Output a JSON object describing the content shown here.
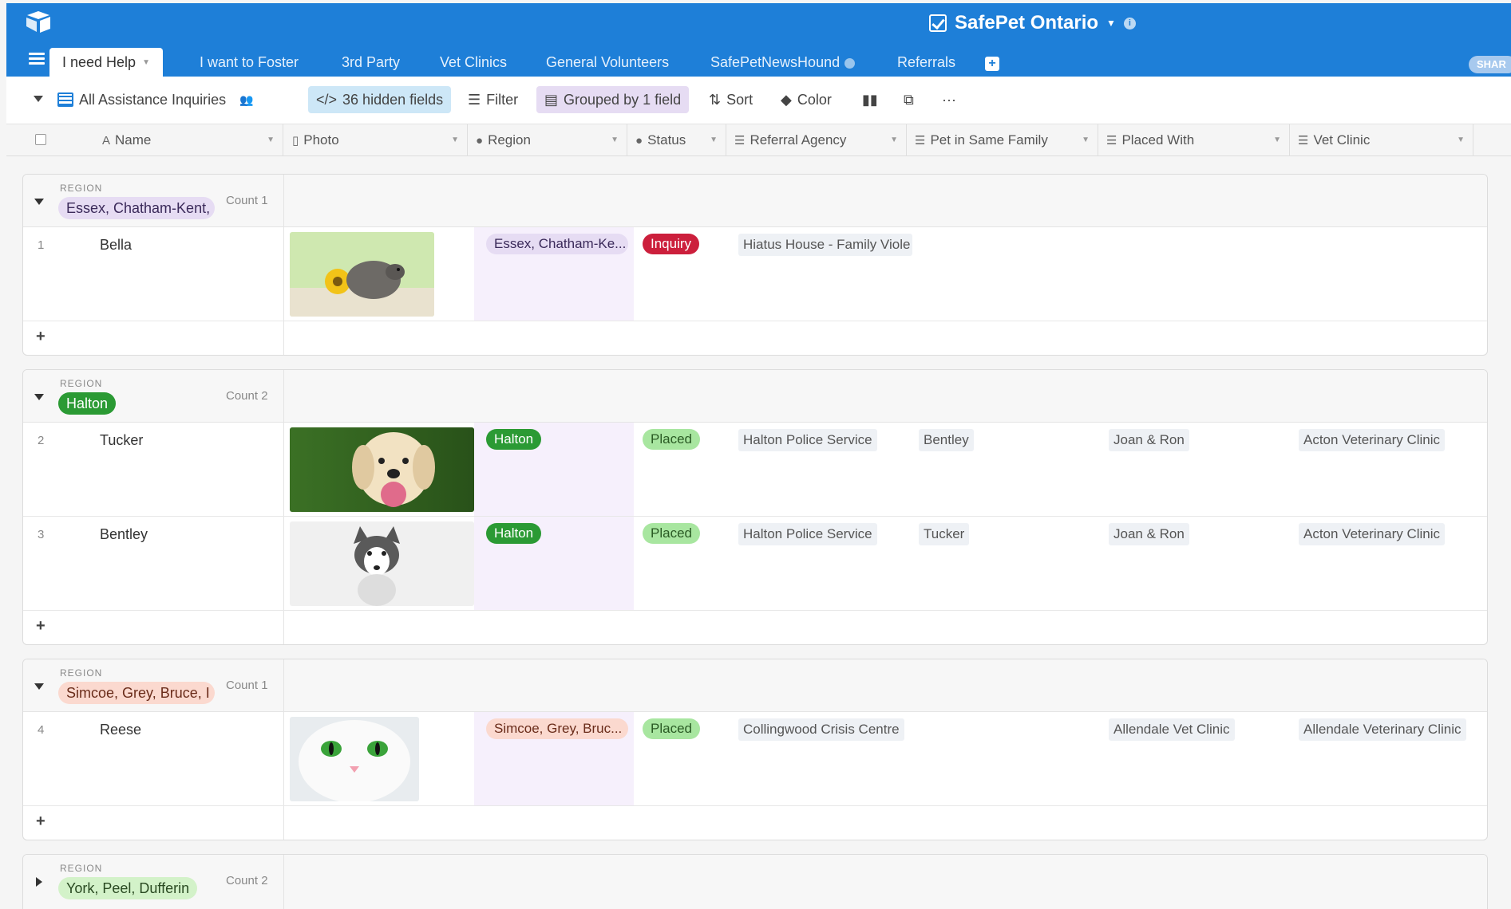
{
  "app": {
    "base_title": "SafePet Ontario",
    "share_label": "SHAR"
  },
  "tabs": [
    {
      "label": "I need Help"
    },
    {
      "label": "I want to Foster"
    },
    {
      "label": "3rd Party"
    },
    {
      "label": "Vet Clinics"
    },
    {
      "label": "General Volunteers"
    },
    {
      "label": "SafePetNewsHound"
    },
    {
      "label": "Referrals"
    }
  ],
  "toolbar": {
    "view_name": "All Assistance Inquiries",
    "hidden_fields": "36 hidden fields",
    "filter": "Filter",
    "grouped": "Grouped by 1 field",
    "sort": "Sort",
    "color": "Color",
    "more": "···"
  },
  "columns": [
    "Name",
    "Photo",
    "Region",
    "Status",
    "Referral Agency",
    "Pet in Same Family",
    "Placed With",
    "Vet Clinic"
  ],
  "group_label": "REGION",
  "groups": [
    {
      "name": "Essex, Chatham-Kent,",
      "count": "Count 1",
      "rows": [
        {
          "num": "1",
          "name": "Bella",
          "region": "Essex, Chatham-Ke...",
          "status": "Inquiry",
          "referral": "Hiatus House - Family Viole",
          "same_family": "",
          "placed_with": "",
          "vet": ""
        }
      ]
    },
    {
      "name": "Halton",
      "count": "Count 2",
      "rows": [
        {
          "num": "2",
          "name": "Tucker",
          "region": "Halton",
          "status": "Placed",
          "referral": "Halton Police Service",
          "same_family": "Bentley",
          "placed_with": "Joan & Ron",
          "vet": "Acton Veterinary Clinic"
        },
        {
          "num": "3",
          "name": "Bentley",
          "region": "Halton",
          "status": "Placed",
          "referral": "Halton Police Service",
          "same_family": "Tucker",
          "placed_with": "Joan & Ron",
          "vet": "Acton Veterinary Clinic"
        }
      ]
    },
    {
      "name": "Simcoe, Grey, Bruce, I",
      "count": "Count 1",
      "rows": [
        {
          "num": "4",
          "name": "Reese",
          "region": "Simcoe, Grey, Bruc...",
          "status": "Placed",
          "referral": "Collingwood Crisis Centre",
          "same_family": "",
          "placed_with": "Allendale Vet Clinic",
          "vet": "Allendale Veterinary Clinic"
        }
      ]
    },
    {
      "name": "York, Peel, Dufferin",
      "count": "Count 2",
      "rows": []
    }
  ],
  "colors": {
    "brand": "#1e7fd8",
    "inquiry": "#cc1f3c",
    "placed_bg": "#a8e6a0",
    "halton": "#2b9a34",
    "essex_bg": "#e6dcf3",
    "simcoe_bg": "#fbd9cf",
    "york_bg": "#d3f2c9"
  }
}
